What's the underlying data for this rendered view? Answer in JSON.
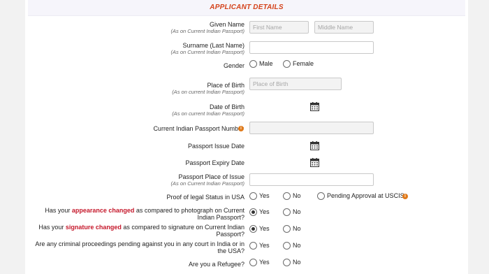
{
  "header": {
    "title": "APPLICANT DETAILS"
  },
  "given_name": {
    "label": "Given Name",
    "sub": "(As on Current Indian Passport)",
    "first_placeholder": "First Name",
    "middle_placeholder": "Middle Name"
  },
  "surname": {
    "label": "Surname (Last Name)",
    "sub": "(As on Current Indian Passport)"
  },
  "gender": {
    "label": "Gender",
    "options": [
      "Male",
      "Female"
    ]
  },
  "place_of_birth": {
    "label": "Place of Birth",
    "sub": "(As on current Indian Passport)",
    "placeholder": "Place of Birth"
  },
  "date_of_birth": {
    "label": "Date of Birth",
    "sub": "(As on current Indian Passport)"
  },
  "passport_number": {
    "label": "Current Indian Passport Number",
    "info_icon": "info-icon"
  },
  "issue_date": {
    "label": "Passport Issue Date"
  },
  "expiry_date": {
    "label": "Passport Expiry Date"
  },
  "place_of_issue": {
    "label": "Passport Place of Issue",
    "sub": "(As on Current Indian Passport)"
  },
  "legal_status": {
    "label": "Proof of legal Status in USA",
    "options": [
      "Yes",
      "No",
      "Pending Approval at USCIS"
    ]
  },
  "appearance": {
    "pre": "Has your ",
    "highlight": "appearance changed",
    "post": " as compared to photograph on Current Indian Passport?",
    "yes": "Yes",
    "no": "No",
    "selected": "Yes"
  },
  "signature": {
    "pre": "Has your ",
    "highlight": "signature changed",
    "post": " as compared to signature on Current Indian Passport?",
    "yes": "Yes",
    "no": "No",
    "selected": "Yes"
  },
  "criminal": {
    "question": "Are any criminal proceedings pending against you in any court in India or in the USA?",
    "yes": "Yes",
    "no": "No"
  },
  "refugee": {
    "question": "Are you a Refugee?",
    "yes": "Yes",
    "no": "No"
  },
  "colors": {
    "header_text": "#d4431c",
    "highlight": "#c5182b",
    "info": "#e07a1a"
  }
}
